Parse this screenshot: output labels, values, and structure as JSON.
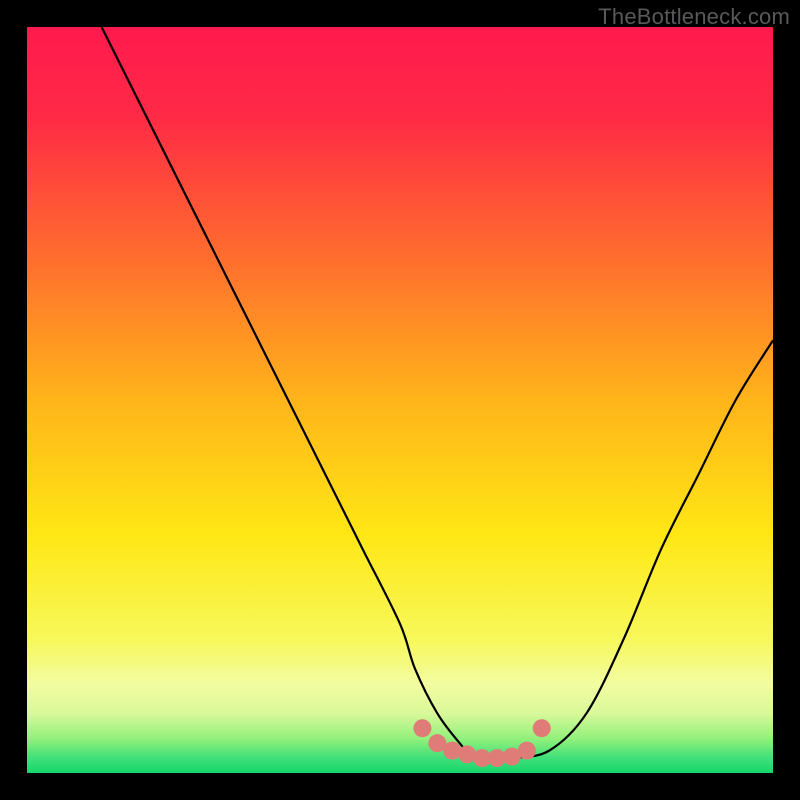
{
  "watermark": "TheBottleneck.com",
  "colors": {
    "frame": "#000000",
    "gradient_stops": [
      {
        "offset": 0.0,
        "color": "#ff1a4e"
      },
      {
        "offset": 0.12,
        "color": "#ff2a45"
      },
      {
        "offset": 0.3,
        "color": "#ff6a2f"
      },
      {
        "offset": 0.5,
        "color": "#ffb41a"
      },
      {
        "offset": 0.68,
        "color": "#ffe714"
      },
      {
        "offset": 0.82,
        "color": "#f7f85a"
      },
      {
        "offset": 0.88,
        "color": "#f3fca0"
      },
      {
        "offset": 0.92,
        "color": "#d9f99a"
      },
      {
        "offset": 0.955,
        "color": "#8ff07a"
      },
      {
        "offset": 0.98,
        "color": "#3fe07a"
      },
      {
        "offset": 1.0,
        "color": "#16d66b"
      }
    ],
    "curve": "#000000",
    "marker_fill": "#e07c78",
    "marker_stroke": "#c86763"
  },
  "chart_data": {
    "type": "line",
    "title": "",
    "xlabel": "",
    "ylabel": "",
    "xlim": [
      0,
      100
    ],
    "ylim": [
      0,
      100
    ],
    "series": [
      {
        "name": "bottleneck-curve",
        "x": [
          10,
          15,
          20,
          25,
          30,
          35,
          40,
          45,
          50,
          52,
          55,
          58,
          60,
          62,
          65,
          70,
          75,
          80,
          85,
          90,
          95,
          100
        ],
        "y": [
          100,
          90,
          80,
          70,
          60,
          50,
          40,
          30,
          20,
          14,
          8,
          4,
          2,
          2,
          2,
          3,
          8,
          18,
          30,
          40,
          50,
          58
        ]
      }
    ],
    "markers": {
      "name": "optimal-range",
      "x": [
        53,
        55,
        57,
        59,
        61,
        63,
        65,
        67,
        69
      ],
      "y": [
        6,
        4,
        3,
        2.5,
        2,
        2,
        2.2,
        3,
        6
      ]
    }
  }
}
